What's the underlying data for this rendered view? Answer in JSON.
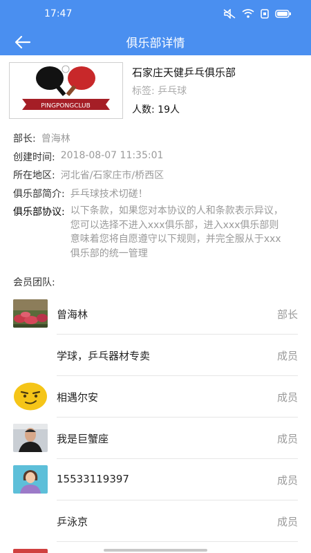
{
  "status_bar": {
    "time": "17:47"
  },
  "app_bar": {
    "title": "俱乐部详情"
  },
  "club": {
    "logo_text": "PINGPONGCLUB",
    "name": "石家庄天健乒乓俱乐部",
    "tag": "标签: 乒乓球",
    "count": "人数: 19人"
  },
  "info": {
    "leader_label": "部长:",
    "leader_value": "曾海林",
    "created_label": "创建时间:",
    "created_value": "2018-08-07 11:35:01",
    "region_label": "所在地区:",
    "region_value": "河北省/石家庄市/桥西区",
    "intro_label": "俱乐部简介:",
    "intro_value": "乒乓球技术切磋！",
    "agreement_label": "俱乐部协议:",
    "agreement_value": "以下条款，如果您对本协议的人和条款表示异议，您可以选择不进入xxx俱乐部，进入xxx俱乐部则意味着您将自愿遵守以下规则，并完全服从于xxx俱乐部的统一管理"
  },
  "team": {
    "label": "会员团队:",
    "members": [
      {
        "name": "曾海林",
        "role": "部长",
        "avatar": "flowers-photo"
      },
      {
        "name": "学球，乒乓器材专卖",
        "role": "成员",
        "avatar": "none"
      },
      {
        "name": "相遇尔安",
        "role": "成员",
        "avatar": "smirk-emoji"
      },
      {
        "name": "我是巨蟹座",
        "role": "成员",
        "avatar": "man-photo"
      },
      {
        "name": "15533119397",
        "role": "成员",
        "avatar": "default-person"
      },
      {
        "name": "乒泳京",
        "role": "成员",
        "avatar": "none"
      }
    ]
  },
  "colors": {
    "primary": "#4a8ff0",
    "secondary_text": "#9a9a9a"
  }
}
